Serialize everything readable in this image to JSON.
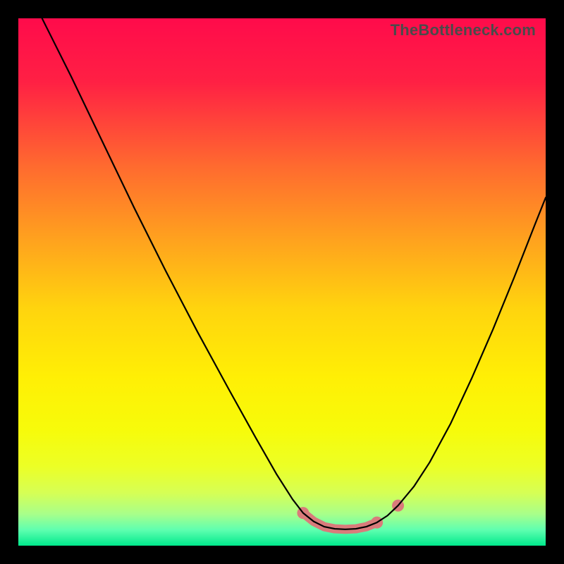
{
  "watermark": "TheBottleneck.com",
  "chart_data": {
    "type": "line",
    "title": "",
    "xlabel": "",
    "ylabel": "",
    "xlim": [
      0,
      100
    ],
    "ylim": [
      0,
      100
    ],
    "gradient_stops": [
      {
        "offset": 0.0,
        "color": "#ff0b4b"
      },
      {
        "offset": 0.12,
        "color": "#ff2044"
      },
      {
        "offset": 0.28,
        "color": "#ff6a2f"
      },
      {
        "offset": 0.42,
        "color": "#ffa21e"
      },
      {
        "offset": 0.55,
        "color": "#ffd40e"
      },
      {
        "offset": 0.68,
        "color": "#ffef05"
      },
      {
        "offset": 0.78,
        "color": "#f7fb0a"
      },
      {
        "offset": 0.85,
        "color": "#ecff26"
      },
      {
        "offset": 0.9,
        "color": "#d6ff55"
      },
      {
        "offset": 0.94,
        "color": "#a8ff8a"
      },
      {
        "offset": 0.97,
        "color": "#5fffb0"
      },
      {
        "offset": 1.0,
        "color": "#00e98c"
      }
    ],
    "series": [
      {
        "name": "bottleneck-curve",
        "stroke": "#000000",
        "stroke_width": 2.2,
        "points": [
          {
            "x": 4.5,
            "y": 100.0
          },
          {
            "x": 6.0,
            "y": 97.0
          },
          {
            "x": 10.0,
            "y": 89.0
          },
          {
            "x": 16.0,
            "y": 76.5
          },
          {
            "x": 22.0,
            "y": 64.0
          },
          {
            "x": 28.0,
            "y": 52.0
          },
          {
            "x": 34.0,
            "y": 40.5
          },
          {
            "x": 40.0,
            "y": 29.5
          },
          {
            "x": 45.0,
            "y": 20.5
          },
          {
            "x": 49.0,
            "y": 13.5
          },
          {
            "x": 52.0,
            "y": 8.8
          },
          {
            "x": 54.0,
            "y": 6.2
          },
          {
            "x": 56.0,
            "y": 4.6
          },
          {
            "x": 58.0,
            "y": 3.6
          },
          {
            "x": 60.0,
            "y": 3.2
          },
          {
            "x": 62.0,
            "y": 3.1
          },
          {
            "x": 64.0,
            "y": 3.2
          },
          {
            "x": 66.0,
            "y": 3.6
          },
          {
            "x": 68.0,
            "y": 4.4
          },
          {
            "x": 70.0,
            "y": 5.7
          },
          {
            "x": 72.0,
            "y": 7.6
          },
          {
            "x": 75.0,
            "y": 11.2
          },
          {
            "x": 78.0,
            "y": 15.8
          },
          {
            "x": 82.0,
            "y": 23.2
          },
          {
            "x": 86.0,
            "y": 31.8
          },
          {
            "x": 90.0,
            "y": 41.0
          },
          {
            "x": 94.0,
            "y": 50.8
          },
          {
            "x": 98.0,
            "y": 61.0
          },
          {
            "x": 100.0,
            "y": 66.0
          }
        ]
      }
    ],
    "highlight": {
      "color": "#d97b7b",
      "stroke_width": 13,
      "dot_radius": 8.5,
      "points": [
        {
          "x": 54.0,
          "y": 6.2
        },
        {
          "x": 56.0,
          "y": 4.6
        },
        {
          "x": 58.0,
          "y": 3.6
        },
        {
          "x": 60.0,
          "y": 3.2
        },
        {
          "x": 62.0,
          "y": 3.1
        },
        {
          "x": 64.0,
          "y": 3.2
        },
        {
          "x": 66.0,
          "y": 3.6
        },
        {
          "x": 68.0,
          "y": 4.4
        }
      ],
      "isolated_dot": {
        "x": 72.0,
        "y": 7.6
      }
    }
  }
}
